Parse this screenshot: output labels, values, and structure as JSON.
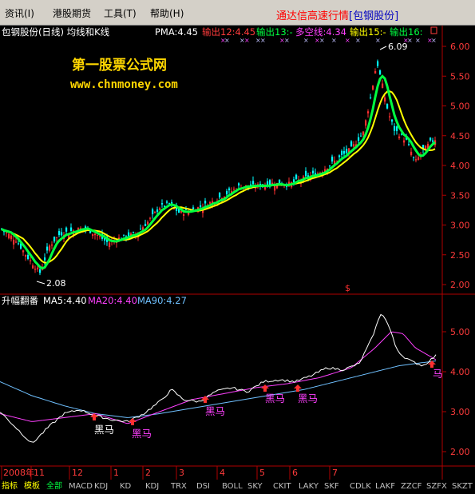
{
  "menu": {
    "items": [
      "资讯(I)",
      "港股期货",
      "工具(T)",
      "帮助(H)"
    ],
    "title_main": "通达信高速行情",
    "title_stock": "[包钢股份]"
  },
  "main_panel": {
    "title": "包钢股份(日线) 均线和K线",
    "pma": "PMA:4.45",
    "out12": "输出12:4.45",
    "out13": "输出13:-",
    "longshort": "多空线:4.34",
    "out15": "输出15:-",
    "out16": "输出16:",
    "y_ticks": [
      "6.00",
      "5.50",
      "5.00",
      "4.50",
      "4.00",
      "3.50",
      "3.00",
      "2.50",
      "2.00"
    ],
    "high_label": "6.09",
    "low_label": "2.08",
    "s_marker": "$",
    "watermark_cn": "第一股票公式网",
    "watermark_url": "www.chnmoney.com"
  },
  "sub_panel": {
    "title": "升幅翻番",
    "ma5": "MA5:4.40",
    "ma20": "MA20:4.40",
    "ma90": "MA90:4.27",
    "y_ticks": [
      "5.00",
      "4.00",
      "3.00",
      "2.00"
    ],
    "signal_text": "黑马",
    "signal_text_alt": "马"
  },
  "time_axis": {
    "labels": [
      "2008年",
      "11",
      "12",
      "1",
      "2",
      "3",
      "4",
      "5",
      "6",
      "7"
    ]
  },
  "tabs": [
    "指标",
    "模板",
    "全部",
    "MACD",
    "KDJ",
    "KD",
    "KDJ",
    "TRX",
    "DSI",
    "BOLL",
    "SKY",
    "CKIT",
    "LAKY",
    "SKF",
    "CDLK",
    "LAKF",
    "ZZCF",
    "SZFX",
    "SKZT"
  ],
  "colors": {
    "candle_up": "#ff3030",
    "candle_down": "#00ffff",
    "ma_yellow": "#ffff00",
    "ma_green": "#00ff40",
    "axis": "#b00000",
    "text_red": "#ff3b3b",
    "magenta": "#ff40ff",
    "sky": "#6fc0ff"
  }
}
